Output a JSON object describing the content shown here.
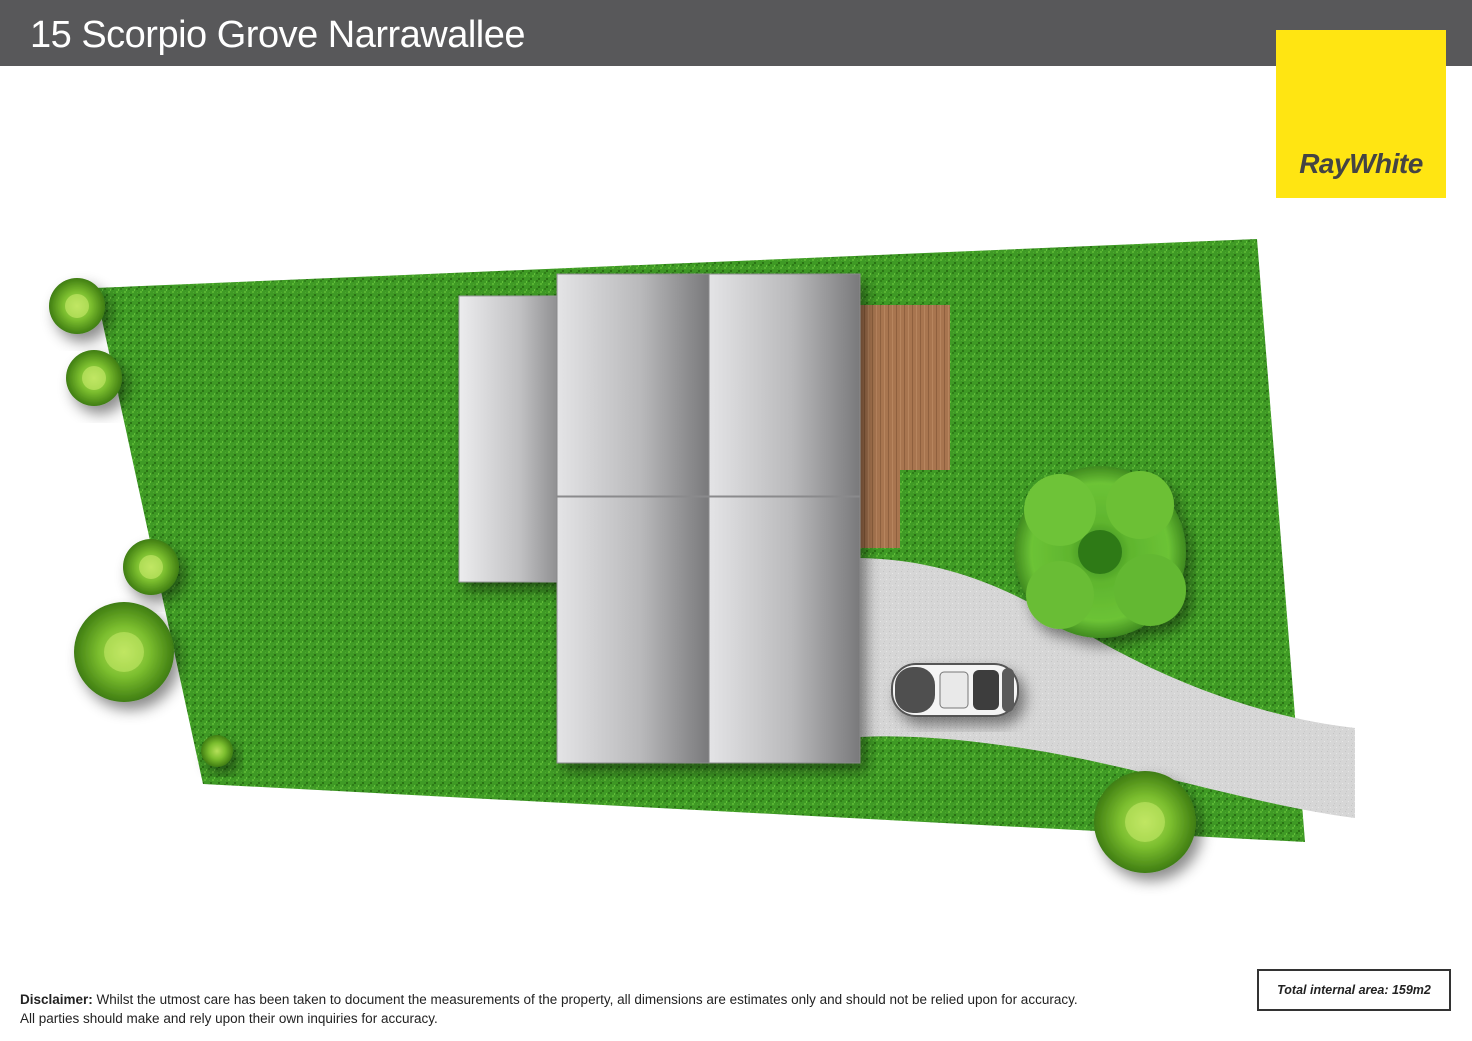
{
  "header": {
    "title": "15 Scorpio Grove Narrawallee"
  },
  "logo": {
    "text": "RayWhite",
    "background": "#ffe512"
  },
  "colors": {
    "header_bar": "#58585a",
    "lawn": "#3f9a25",
    "deck": "#a8754f",
    "driveway": "#d6d6d6",
    "roof": "#b5b5b7"
  },
  "footer": {
    "disclaimer_label": "Disclaimer:",
    "disclaimer_line1": " Whilst the utmost care has been taken to document the measurements of the property, all dimensions are estimates only and should not be relied upon for accuracy.",
    "disclaimer_line2": "All parties should make and rely upon their own inquiries for accuracy.",
    "area": "Total internal area: 159m2"
  },
  "icons": [
    "shrub-icon",
    "tree-icon",
    "car-icon"
  ]
}
